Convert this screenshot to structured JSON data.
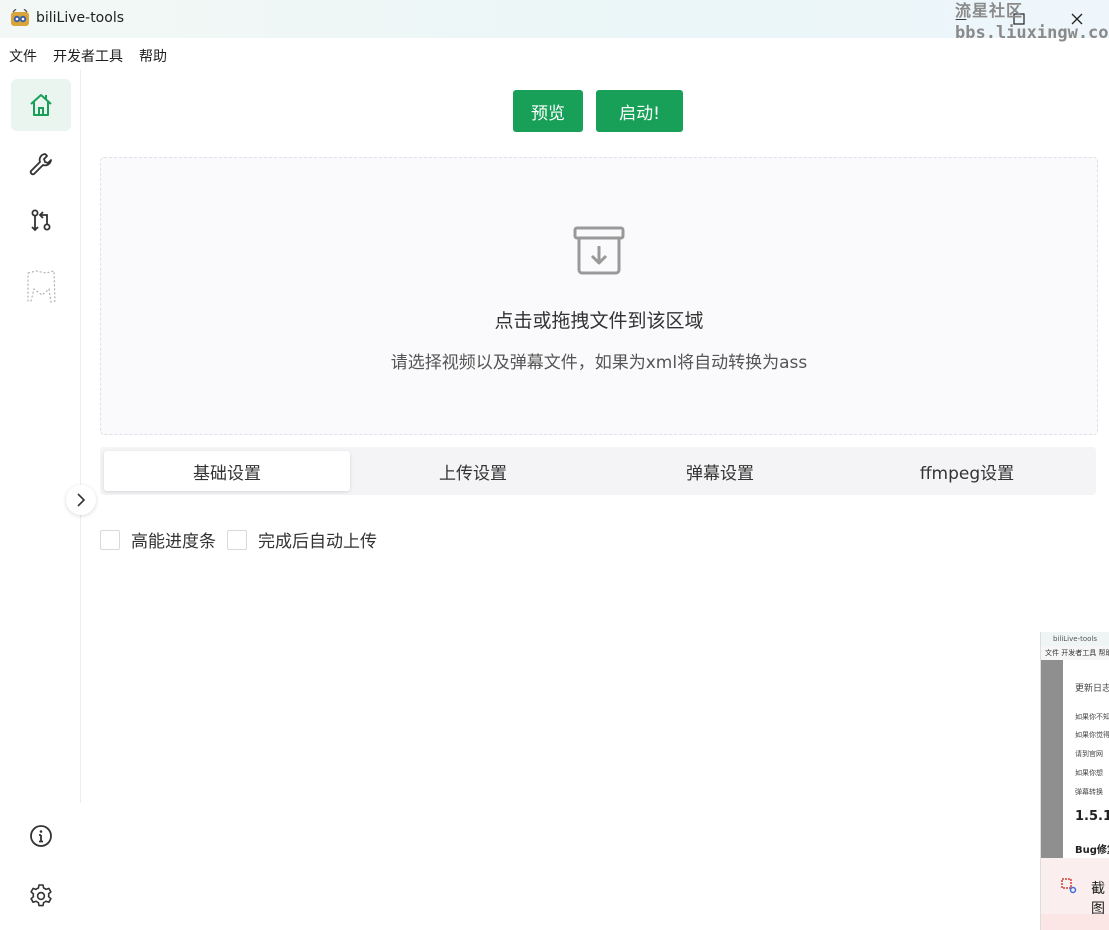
{
  "window": {
    "title": "biliLive-tools",
    "minimize_glyph": "—",
    "close_glyph": "✕"
  },
  "watermark": {
    "line1": "流星社区",
    "line2": "bbs.liuxingw.com"
  },
  "menu": [
    "文件",
    "开发者工具",
    "帮助"
  ],
  "sidebar": {
    "items": [
      {
        "icon": "home-icon",
        "active": true
      },
      {
        "icon": "wrench-icon",
        "active": false
      },
      {
        "icon": "git-compare-icon",
        "active": false
      },
      {
        "icon": "dotted-shape-icon",
        "active": false
      }
    ],
    "bottom_items": [
      {
        "icon": "info-icon"
      },
      {
        "icon": "settings-gear-icon"
      }
    ]
  },
  "toolbar": {
    "preview_label": "预览",
    "start_label": "启动!"
  },
  "dropzone": {
    "title": "点击或拖拽文件到该区域",
    "subtitle": "请选择视频以及弹幕文件，如果为xml将自动转换为ass"
  },
  "tabs": [
    {
      "label": "基础设置",
      "active": true
    },
    {
      "label": "上传设置",
      "active": false
    },
    {
      "label": "弹幕设置",
      "active": false
    },
    {
      "label": "ffmpeg设置",
      "active": false
    }
  ],
  "options": [
    {
      "label": "高能进度条",
      "checked": false
    },
    {
      "label": "完成后自动上传",
      "checked": false
    }
  ],
  "thumbnail": {
    "title": "biliLive-tools",
    "menu": "文件 开发者工具 帮助",
    "lines": [
      "更新日志",
      "如果你不知",
      "如果你觉得",
      "请到官网",
      "如果你想",
      "弹幕转换"
    ],
    "version": "1.5.1",
    "bug": "Bug修复",
    "snip": "截图"
  },
  "colors": {
    "accent": "#18a058",
    "active_nav_bg": "#e9f5ee"
  }
}
